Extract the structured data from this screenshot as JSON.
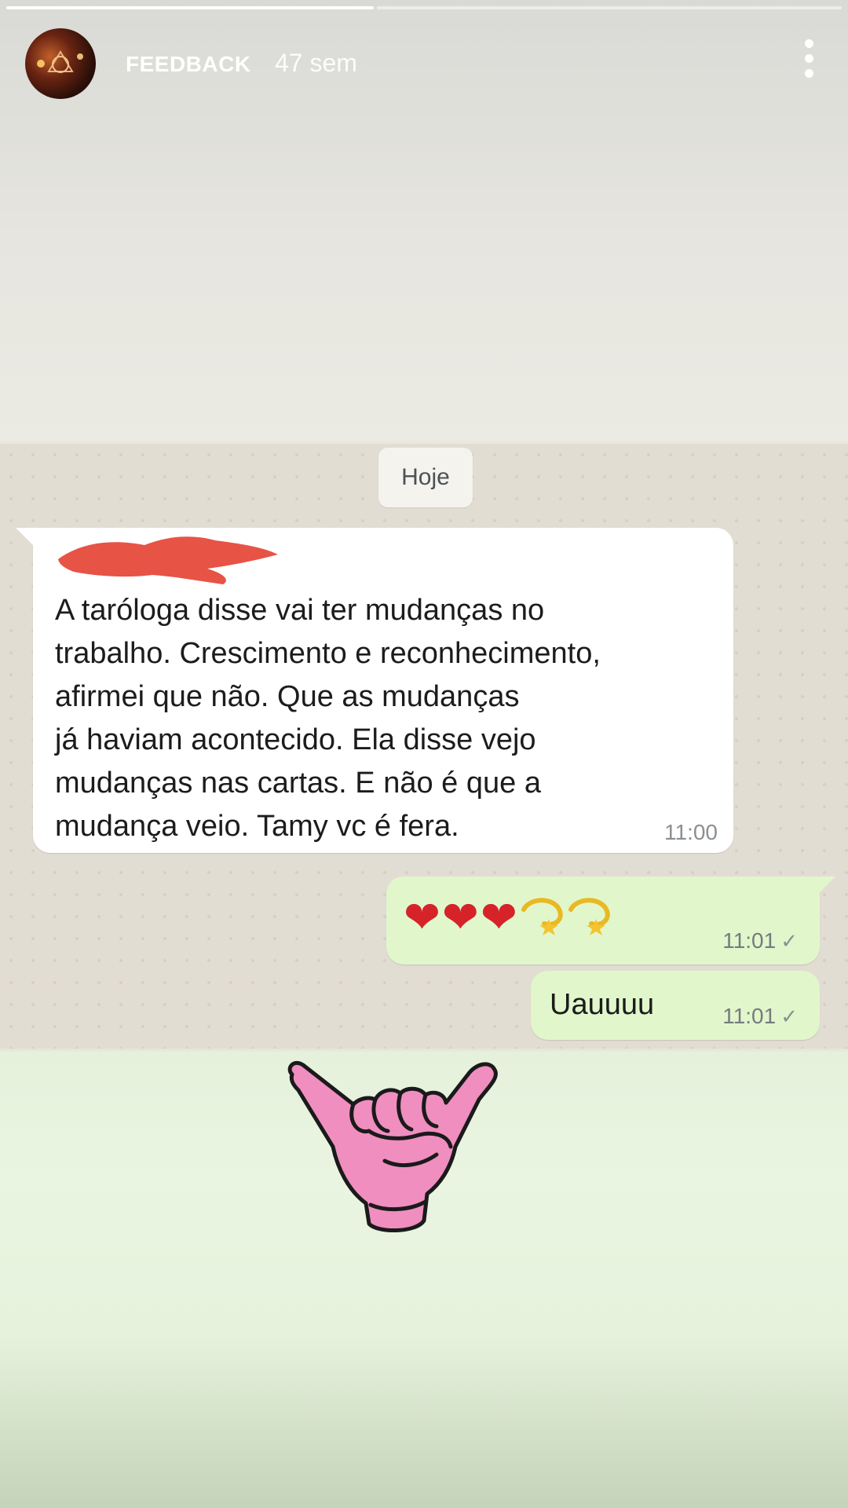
{
  "story": {
    "account_name": "FEEDBACK",
    "posted_ago": "47 sem",
    "progress": 0.44
  },
  "chat": {
    "date_chip": "Hoje",
    "incoming": {
      "text": "A taróloga disse vai ter mudanças no\ntrabalho. Crescimento e reconhecimento,\nafirmei que não. Que as mudanças\njá haviam acontecido.  Ela disse vejo\nmudanças nas cartas. E não é que a\nmudança veio. Tamy vc é fera.",
      "time": "11:00"
    },
    "outgoing": [
      {
        "content": "❤️❤️❤️💫💫",
        "time": "11:01",
        "status": "✓"
      },
      {
        "content": "Uauuuu",
        "time": "11:01",
        "status": "✓"
      }
    ]
  },
  "sticker": {
    "icon": "shaka-hand-icon",
    "color": "#f08ec0"
  },
  "colors": {
    "outgoing_bubble": "#e1f7cb",
    "incoming_bubble": "#ffffff",
    "story_bg": "#e6f2dc"
  }
}
